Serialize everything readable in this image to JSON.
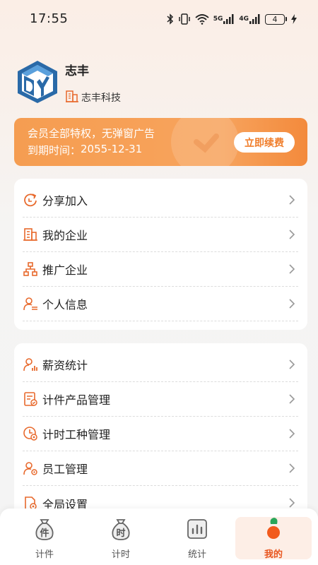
{
  "status_bar": {
    "time": "17:55",
    "network1": "5G",
    "network2": "4G",
    "battery": "4"
  },
  "profile": {
    "name": "志丰",
    "company": "志丰科技",
    "avatar_icon": "dy-logo-avatar"
  },
  "vip": {
    "line1": "会员全部特权，无弹窗广告",
    "expiry_label": "到期时间：",
    "expiry_date": "2055-12-31",
    "renew_label": "立即续费"
  },
  "menu_group1": [
    {
      "label": "分享加入",
      "icon": "share-join-icon"
    },
    {
      "label": "我的企业",
      "icon": "building-icon"
    },
    {
      "label": "推广企业",
      "icon": "org-chart-icon"
    },
    {
      "label": "个人信息",
      "icon": "person-info-icon"
    }
  ],
  "menu_group2": [
    {
      "label": "薪资统计",
      "icon": "salary-stats-icon"
    },
    {
      "label": "计件产品管理",
      "icon": "piece-product-icon"
    },
    {
      "label": "计时工种管理",
      "icon": "time-work-icon"
    },
    {
      "label": "员工管理",
      "icon": "employee-icon"
    },
    {
      "label": "全局设置",
      "icon": "global-settings-icon"
    }
  ],
  "tabs": [
    {
      "label": "计件",
      "glyph": "件",
      "active": false
    },
    {
      "label": "计时",
      "glyph": "时",
      "active": false
    },
    {
      "label": "统计",
      "active": false
    },
    {
      "label": "我的",
      "active": true
    }
  ],
  "colors": {
    "accent": "#f07d2a",
    "icon_orange": "#e8692c",
    "active_tab": "#e8551e"
  }
}
